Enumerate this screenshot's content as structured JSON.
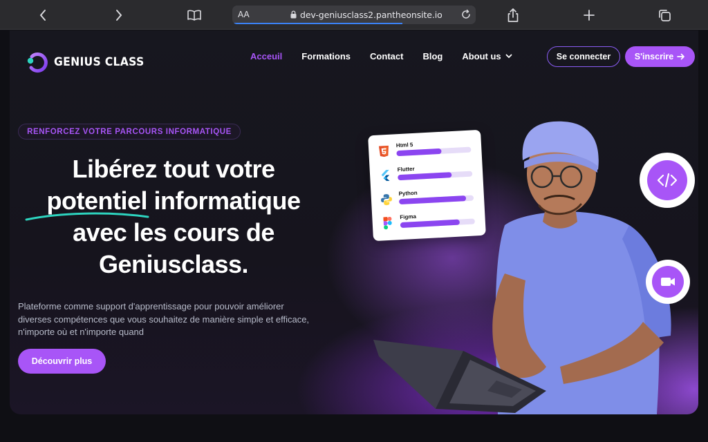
{
  "browser": {
    "text_size_label": "AA",
    "url": "dev-geniusclass2.pantheonsite.io",
    "load_progress": 0.7
  },
  "header": {
    "logo_text": "GENIUS CLASS",
    "nav": [
      {
        "label": "Acceuil",
        "active": true
      },
      {
        "label": "Formations",
        "active": false
      },
      {
        "label": "Contact",
        "active": false
      },
      {
        "label": "Blog",
        "active": false
      },
      {
        "label": "About us",
        "active": false,
        "has_dropdown": true
      }
    ],
    "login_label": "Se connecter",
    "signup_label": "S'inscrire"
  },
  "hero": {
    "tag": "RENFORCEZ VOTRE PARCOURS INFORMATIQUE",
    "headline_lines": [
      "Libérez tout votre",
      "potentiel informatique",
      "avec les cours de",
      "Geniusclass."
    ],
    "subtext_lines": [
      "Plateforme comme support d'apprentissage pour pouvoir améliorer",
      "diverses compétences que vous souhaitez de manière simple et efficace,",
      "n'importe où et n'importe quand"
    ],
    "cta_label": "Découvrir plus"
  },
  "skills": [
    {
      "name": "Html 5",
      "icon": "html5-icon",
      "level": 0.6
    },
    {
      "name": "Flutter",
      "icon": "flutter-icon",
      "level": 0.72
    },
    {
      "name": "Python",
      "icon": "python-icon",
      "level": 0.9
    },
    {
      "name": "Figma",
      "icon": "figma-icon",
      "level": 0.8
    }
  ],
  "colors": {
    "accent": "#a855f7",
    "background": "#111116"
  }
}
